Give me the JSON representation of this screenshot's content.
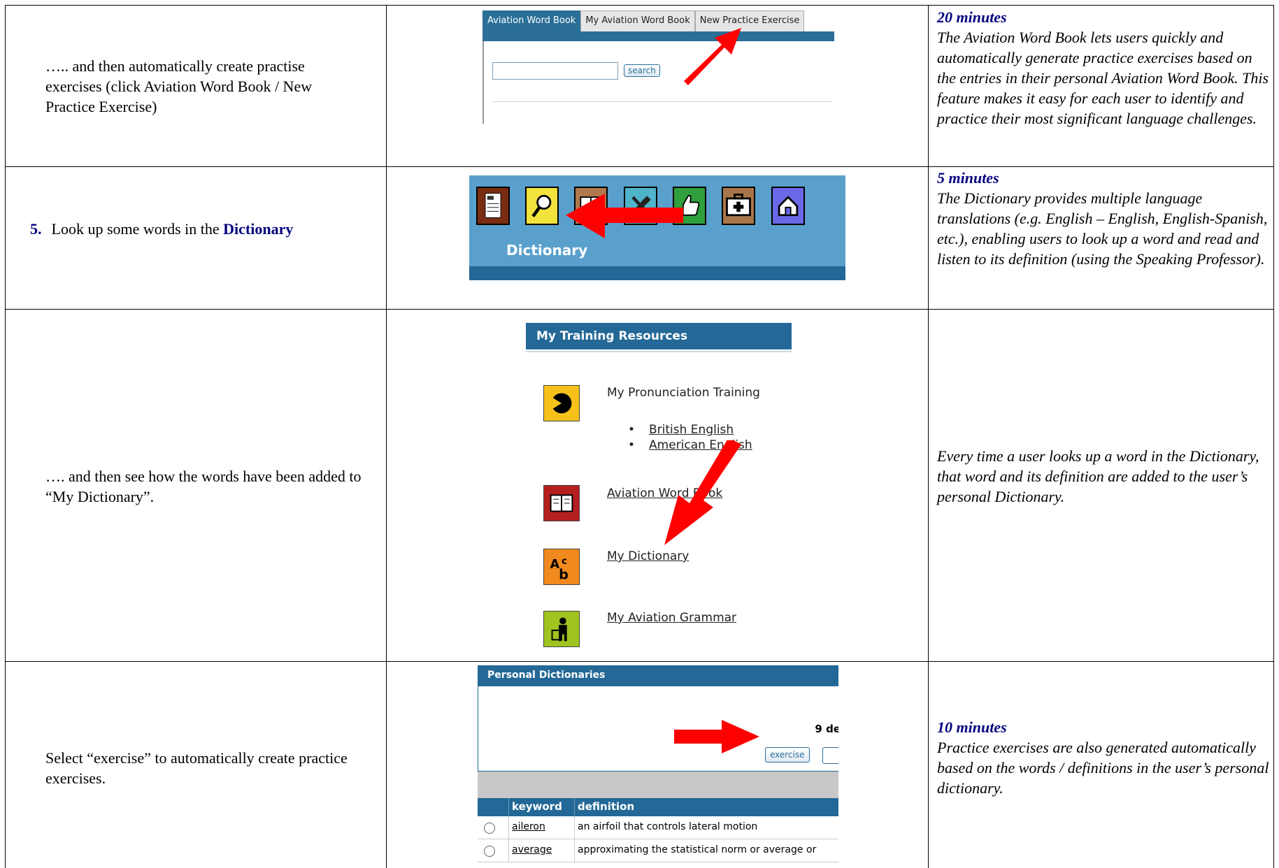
{
  "rows": [
    {
      "left": "….. and then automatically create practise exercises (click Aviation Word Book / New Practice Exercise)",
      "right_time": "20 minutes",
      "right_text": "The Aviation Word Book lets users quickly and automatically generate practice exercises based on the entries in their personal Aviation Word Book. This feature makes it easy for each user to identify and practice their most significant language challenges."
    },
    {
      "step": "5.",
      "left_prefix": "Look up some words in the ",
      "left_strong": "Dictionary",
      "right_time": "5 minutes",
      "right_text": "The Dictionary provides multiple language translations (e.g. English – English, English-Spanish, etc.), enabling users to look up a word and read and listen to its definition (using the Speaking Professor)."
    },
    {
      "left": "…. and then see how the words have been added to “My Dictionary”.",
      "right_text": "Every time a user looks up a word in the Dictionary, that word and its definition are added to the user’s personal Dictionary."
    },
    {
      "left": "Select “exercise” to automatically create practice exercises.",
      "right_time": "10 minutes",
      "right_text": "Practice exercises are also generated automatically based on the words / definitions in the user’s personal dictionary."
    }
  ],
  "shot1": {
    "tabs": [
      "Aviation Word Book",
      "My Aviation Word Book",
      "New Practice Exercise"
    ],
    "search_label": "search"
  },
  "shot2": {
    "label": "Dictionary",
    "icons": [
      "document-icon",
      "magnifier-icon",
      "book-icon",
      "tools-icon",
      "thumbs-up-icon",
      "first-aid-icon",
      "home-icon"
    ],
    "icon_colors": [
      "#7b2d12",
      "#f2e23c",
      "#b07a4e",
      "#4fb3c9",
      "#2fa03c",
      "#a8764a",
      "#6a68e6"
    ]
  },
  "shot3": {
    "header": "My Training Resources",
    "pronunciation": "My Pronunciation Training",
    "british": "British English",
    "american": "American English",
    "wordbook": "Aviation Word Book",
    "dictionary": "My Dictionary",
    "grammar": "My Aviation Grammar"
  },
  "shot4": {
    "header": "Personal Dictionaries",
    "count": "9 de",
    "exercise_label": "exercise",
    "col_keyword": "keyword",
    "col_definition": "definition",
    "entries": [
      {
        "keyword": "aileron",
        "definition": "an airfoil that controls lateral motion"
      },
      {
        "keyword": "average",
        "definition": "approximating the statistical norm or average or"
      }
    ]
  }
}
